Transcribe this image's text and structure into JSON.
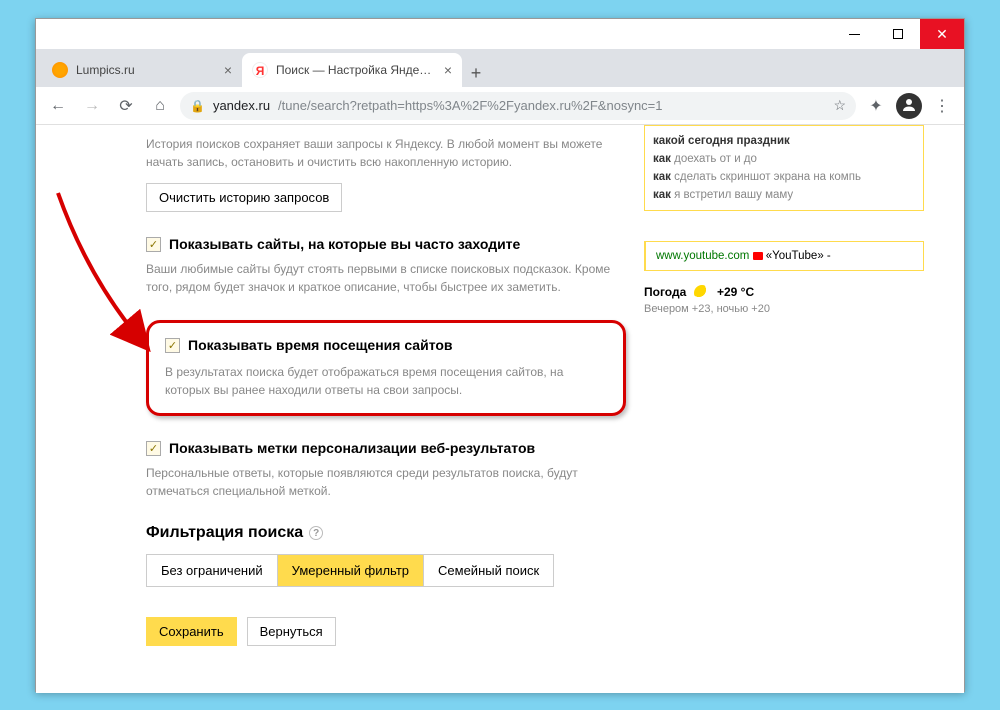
{
  "window_controls": {
    "minimize": "–",
    "maximize": "□",
    "close": "✕"
  },
  "tabs": [
    {
      "title": "Lumpics.ru",
      "active": false
    },
    {
      "title": "Поиск — Настройка Яндекса",
      "active": true
    }
  ],
  "newtab": "+",
  "nav": {
    "back": "←",
    "forward": "→",
    "reload": "⟳",
    "home": "⌂"
  },
  "address": {
    "domain": "yandex.ru",
    "path": "/tune/search?retpath=https%3A%2F%2Fyandex.ru%2F&nosync=1"
  },
  "toolbar_icons": {
    "star": "☆",
    "ext": "✦",
    "menu": "⋮"
  },
  "history": {
    "desc": "История поисков сохраняет ваши запросы к Яндексу. В любой момент вы можете начать запись, остановить и очистить всю накопленную историю.",
    "clear_btn": "Очистить историю запросов"
  },
  "opt_frequent": {
    "label": "Показывать сайты, на которые вы часто заходите",
    "desc": "Ваши любимые сайты будут стоять первыми в списке поисковых подсказок. Кроме того, рядом будет значок и краткое описание, чтобы быстрее их заметить."
  },
  "opt_visittime": {
    "label": "Показывать время посещения сайтов",
    "desc": "В результатах поиска будет отображаться время посещения сайтов, на которых вы ранее находили ответы на свои запросы."
  },
  "opt_personalize": {
    "label": "Показывать метки персонализации веб-результатов",
    "desc": "Персональные ответы, которые появляются среди результатов поиска, будут отмечаться специальной меткой."
  },
  "filter": {
    "heading": "Фильтрация поиска",
    "options": [
      "Без ограничений",
      "Умеренный фильтр",
      "Семейный поиск"
    ]
  },
  "actions": {
    "save": "Сохранить",
    "back": "Вернуться"
  },
  "suggestions": {
    "lines": [
      {
        "bold": "какой сегодня праздник",
        "dim": ""
      },
      {
        "bold": "как",
        "dim": " доехать от и до"
      },
      {
        "bold": "как",
        "dim": " сделать скриншот экрана на компь"
      },
      {
        "bold": "как",
        "dim": " я встретил вашу маму"
      }
    ]
  },
  "preview": {
    "site": "www.youtube.com",
    "title": "«YouTube» -"
  },
  "weather": {
    "label": "Погода",
    "temp": "+29 °C",
    "sub": "Вечером +23, ночью +20"
  },
  "checkmark": "✓",
  "qmark": "?"
}
